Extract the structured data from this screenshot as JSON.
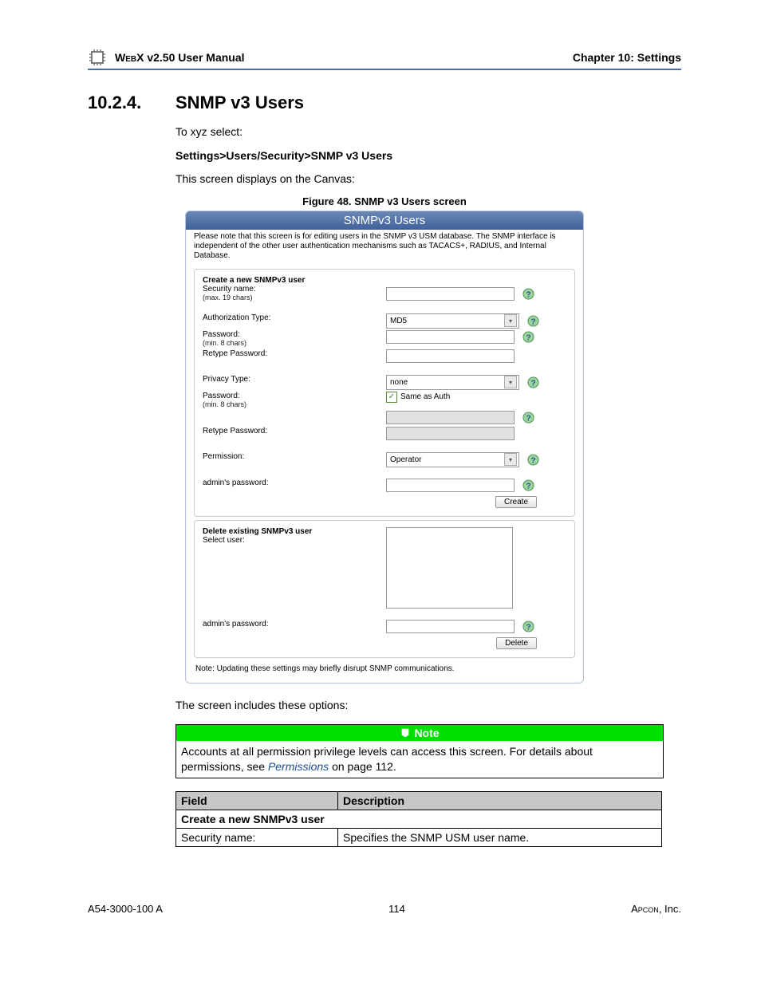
{
  "header": {
    "product_prefix": "Web",
    "product_suffix": "X v2.50 User Manual",
    "chapter": "Chapter 10: Settings"
  },
  "section": {
    "number": "10.2.4.",
    "title": "SNMP v3 Users",
    "intro": "To xyz select:",
    "path": "Settings>Users/Security>SNMP v3 Users",
    "canvas_line": "This screen displays on the Canvas:",
    "figure_caption": "Figure 48. SNMP v3 Users screen",
    "options_line": "The screen includes these options:"
  },
  "screenshot": {
    "title": "SNMPv3 Users",
    "note_text": "Please note that this screen is for editing users in the SNMP v3 USM database. The SNMP interface is independent of the other user authentication mechanisms such as TACACS+, RADIUS, and Internal Database.",
    "create": {
      "heading": "Create a new SNMPv3 user",
      "security_name_label": "Security name:",
      "security_name_hint": "(max. 19 chars)",
      "auth_type_label": "Authorization Type:",
      "auth_type_value": "MD5",
      "password_label": "Password:",
      "password_hint": "(min. 8 chars)",
      "retype_password_label": "Retype Password:",
      "privacy_type_label": "Privacy Type:",
      "privacy_type_value": "none",
      "same_as_auth_label": "Same as Auth",
      "permission_label": "Permission:",
      "permission_value": "Operator",
      "admin_pw_label": "admin's password:",
      "create_btn": "Create"
    },
    "delete": {
      "heading": "Delete existing SNMPv3 user",
      "select_user_label": "Select user:",
      "admin_pw_label": "admin's password:",
      "delete_btn": "Delete"
    },
    "footer_note": "Note: Updating these settings may briefly disrupt SNMP communications."
  },
  "note": {
    "heading": "Note",
    "body_prefix": "Accounts at all permission privilege levels can access this screen. For details about permissions, see ",
    "link": "Permissions",
    "body_suffix": " on page 112."
  },
  "table": {
    "col1": "Field",
    "col2": "Description",
    "span_row": "Create a new SNMPv3 user",
    "r1c1": "Security name:",
    "r1c2": "Specifies the SNMP USM user name."
  },
  "footer": {
    "left": "A54-3000-100 A",
    "center": "114",
    "right_prefix": "A",
    "right_suffix": "pcon",
    "right_tail": ", Inc."
  }
}
